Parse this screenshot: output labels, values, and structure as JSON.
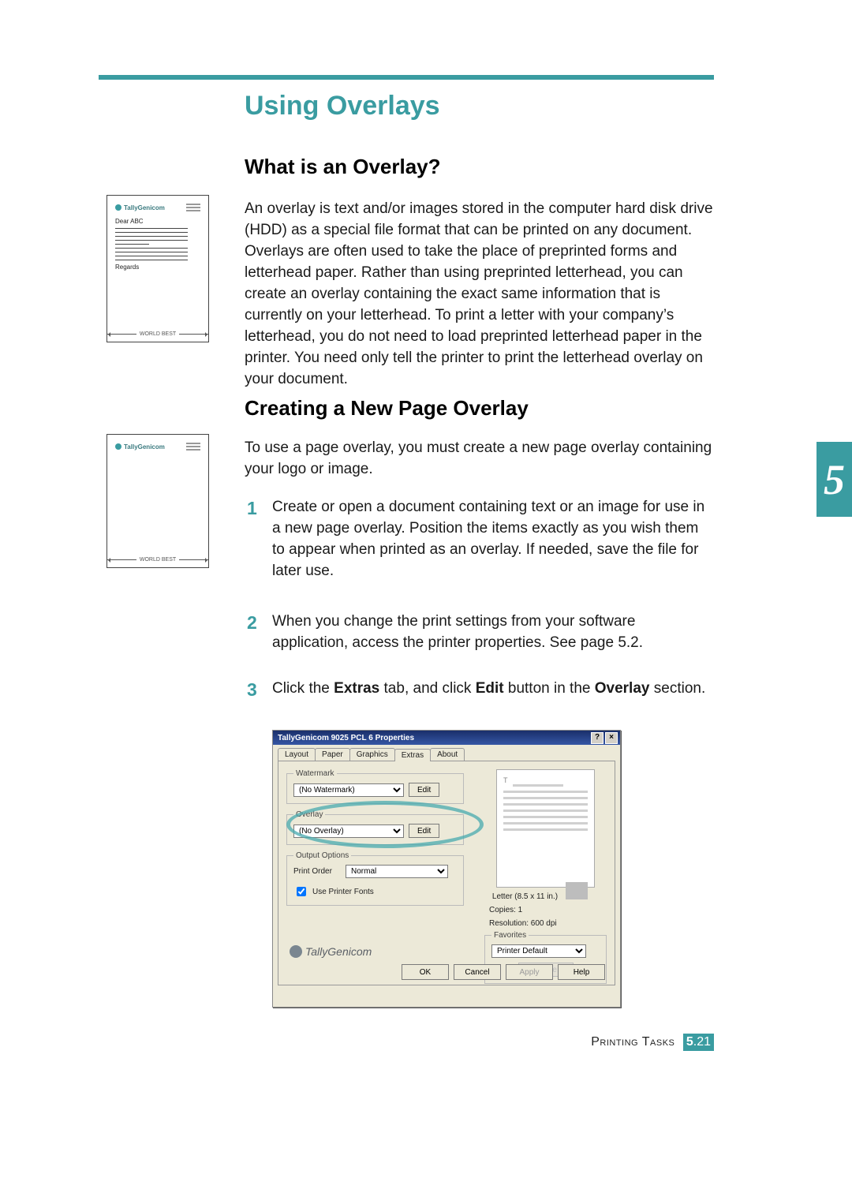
{
  "header": {
    "title": "Using Overlays"
  },
  "sections": {
    "what": {
      "heading": "What is an Overlay?",
      "body": "An overlay is text and/or images stored in the computer hard disk drive (HDD) as a special file format that can be printed on any document. Overlays are often used to take the place of preprinted forms and letterhead paper. Rather than using preprinted letterhead, you can create an overlay containing the exact same information that is currently on your letterhead. To print a letter with your company’s letterhead, you do not need to load preprinted letterhead paper in the printer. You need only tell the printer to print the letterhead overlay on your document."
    },
    "create": {
      "heading": "Creating a New Page Overlay",
      "intro": "To use a page overlay, you must create a new page overlay containing your logo or image.",
      "steps": {
        "s1": "Create or open a document containing text or an image for use in a new page overlay. Position the items exactly as you wish them to appear when printed as an overlay. If needed, save the file for later use.",
        "s2_a": "When you change the print settings from your software application, access the printer properties. See page ",
        "s2_ref": "5.2",
        "s2_b": ".",
        "s3_a": "Click the ",
        "s3_b1": "Extras",
        "s3_c": " tab, and click ",
        "s3_b2": "Edit",
        "s3_d": " button in the ",
        "s3_b3": "Overlay",
        "s3_e": " section."
      }
    }
  },
  "illus": {
    "brand": "TallyGenicom",
    "dear": "Dear ABC",
    "regards": "Regards",
    "footer": "WORLD BEST"
  },
  "chapter_tab": "5",
  "dialog": {
    "title": "TallyGenicom 9025 PCL 6 Properties",
    "tabs": {
      "layout": "Layout",
      "paper": "Paper",
      "graphics": "Graphics",
      "extras": "Extras",
      "about": "About"
    },
    "watermark": {
      "legend": "Watermark",
      "value": "(No Watermark)",
      "edit": "Edit"
    },
    "overlay": {
      "legend": "Overlay",
      "value": "(No Overlay)",
      "edit": "Edit"
    },
    "output": {
      "legend": "Output Options",
      "label": "Print Order",
      "value": "Normal",
      "use_fonts": "Use Printer Fonts"
    },
    "preview_caption": "Letter (8.5 x 11 in.)",
    "copies": "Copies: 1",
    "resolution": "Resolution: 600 dpi",
    "favorites": {
      "legend": "Favorites",
      "value": "Printer Default",
      "delete": "Delete"
    },
    "brand": "TallyGenicom",
    "buttons": {
      "ok": "OK",
      "cancel": "Cancel",
      "apply": "Apply",
      "help": "Help"
    }
  },
  "footer": {
    "section": "Printing Tasks",
    "chapter": "5",
    "pagedot": ".",
    "page": "21"
  }
}
